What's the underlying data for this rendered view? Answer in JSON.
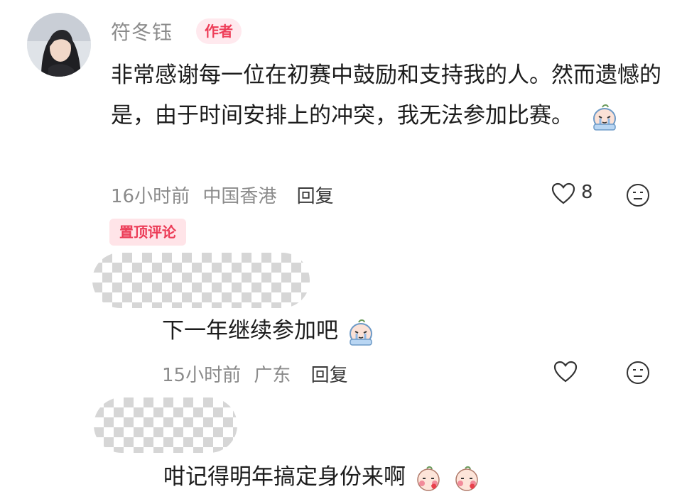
{
  "author_comment": {
    "username": "符冬钰",
    "author_badge": "作者",
    "text": "非常感谢每一位在初赛中鼓励和支持我的人。然而遗憾的是，由于时间安排上的冲突，我无法参加比赛。",
    "meta": {
      "time": "16小时前",
      "location": "中国香港",
      "reply_label": "回复"
    },
    "likes": "8",
    "icons": [
      "heart-icon",
      "emoji-reaction-icon",
      "crying-emoji-icon"
    ]
  },
  "pinned_label": "置顶评论",
  "replies": [
    {
      "text": "下一年继续参加吧",
      "meta": {
        "time": "15小时前",
        "location": "广东",
        "reply_label": "回复"
      },
      "icons": [
        "crying-emoji-icon",
        "heart-icon",
        "emoji-reaction-icon"
      ]
    },
    {
      "text": "咁记得明年搞定身份来啊",
      "icons": [
        "shy-emoji-icon",
        "shy-emoji-icon"
      ]
    }
  ],
  "colors": {
    "badge_text": "#ee3d58",
    "badge_bg": "#ffe9ee",
    "meta_gray": "#8b8b8b",
    "mosaic": "#cfcfcf"
  }
}
